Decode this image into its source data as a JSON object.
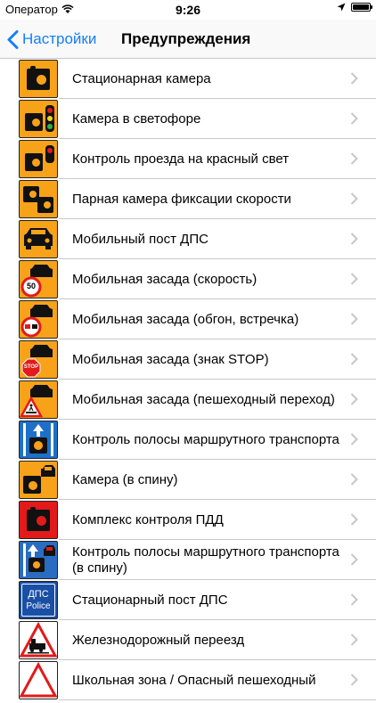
{
  "status": {
    "carrier": "Оператор",
    "time": "9:26"
  },
  "nav": {
    "back_label": "Настройки",
    "title": "Предупреждения"
  },
  "items": [
    {
      "label": "Стационарная камера",
      "icon": "stationary-camera-icon"
    },
    {
      "label": "Камера в светофоре",
      "icon": "traffic-light-camera-icon"
    },
    {
      "label": "Контроль проезда на красный свет",
      "icon": "red-light-control-icon"
    },
    {
      "label": "Парная камера фиксации скорости",
      "icon": "paired-speed-camera-icon"
    },
    {
      "label": "Мобильный пост ДПС",
      "icon": "mobile-police-post-icon"
    },
    {
      "label": "Мобильная засада (скорость)",
      "icon": "mobile-speed-ambush-icon"
    },
    {
      "label": "Мобильная засада (обгон, встречка)",
      "icon": "mobile-overtaking-ambush-icon"
    },
    {
      "label": "Мобильная засада (знак STOP)",
      "icon": "mobile-stop-sign-ambush-icon"
    },
    {
      "label": "Мобильная засада (пешеходный переход)",
      "icon": "mobile-crosswalk-ambush-icon"
    },
    {
      "label": "Контроль полосы маршрутного транспорта",
      "icon": "bus-lane-control-icon"
    },
    {
      "label": "Камера (в спину)",
      "icon": "rear-camera-icon"
    },
    {
      "label": "Комплекс контроля ПДД",
      "icon": "traffic-rules-complex-icon"
    },
    {
      "label": "Контроль полосы маршрутного транспорта (в спину)",
      "icon": "bus-lane-rear-control-icon"
    },
    {
      "label": "Стационарный пост ДПС",
      "icon": "stationary-police-post-icon"
    },
    {
      "label": "Железнодорожный переезд",
      "icon": "railway-crossing-icon"
    },
    {
      "label": "Школьная зона / Опасный пешеходный",
      "icon": "school-zone-icon"
    }
  ],
  "police_icon": {
    "line1": "ДПС",
    "line2": "Police"
  },
  "speed_sign": "50",
  "stop_sign": "STOP",
  "colors": {
    "accent": "#147efb",
    "icon_orange": "#f8a21a",
    "separator": "#c8c7cc"
  }
}
